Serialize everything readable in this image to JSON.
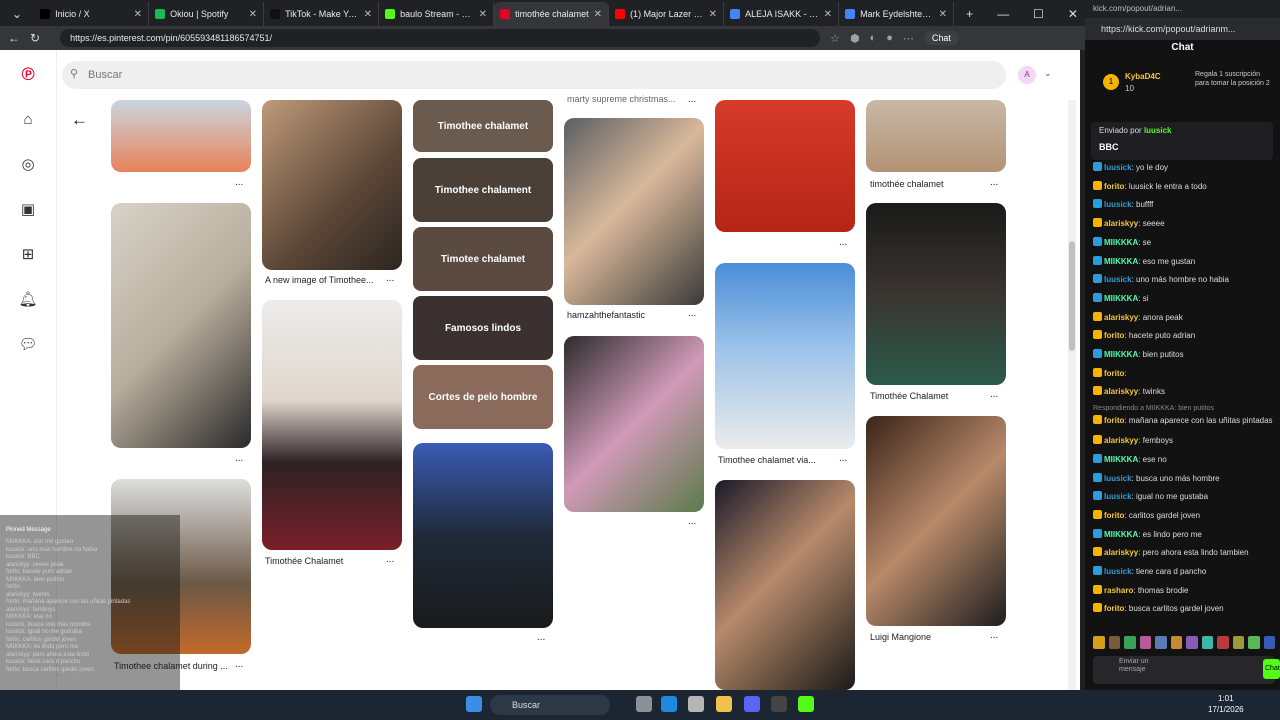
{
  "browser": {
    "tabs": [
      {
        "label": "Inicio / X",
        "icon": "x-logo-icon",
        "color": "#000000",
        "active": false
      },
      {
        "label": "Okiou | Spotify",
        "icon": "spotify-icon",
        "color": "#1db954",
        "active": false
      },
      {
        "label": "TikTok - Make Your Day",
        "icon": "tiktok-icon",
        "color": "#111111",
        "active": false
      },
      {
        "label": "baulo Stream - Watch l",
        "icon": "kick-icon",
        "color": "#53fc18",
        "active": false
      },
      {
        "label": "timothée chalamet",
        "icon": "pinterest-icon",
        "color": "#e60023",
        "active": true
      },
      {
        "label": "(1) Major Lazer & D",
        "icon": "youtube-icon",
        "color": "#ff0000",
        "active": false
      },
      {
        "label": "ALEJA ISAKK - Buscar c",
        "icon": "google-icon",
        "color": "#4285f4",
        "active": false
      },
      {
        "label": "Mark Eydelshteyn - Bus",
        "icon": "google-icon",
        "color": "#4285f4",
        "active": false
      }
    ],
    "url": "https://es.pinterest.com/pin/605593481186574751/",
    "chat_label": "Chat"
  },
  "pinterest": {
    "search_placeholder": "Buscar",
    "avatar_letter": "A",
    "top_cutoff_caption": "marty supreme christmas...",
    "boards": [
      {
        "label": "Timothee chalamet",
        "color": "#6b5a4e"
      },
      {
        "label": "Timothee chalament",
        "color": "#4a4038"
      },
      {
        "label": "Timotee chalamet",
        "color": "#5a4a40"
      },
      {
        "label": "Famosos lindos",
        "color": "#3b3030"
      },
      {
        "label": "Cortes de pelo hombre",
        "color": "#8a6a5a"
      }
    ],
    "pin_captions": {
      "c2_new_image": "A new image of Timothee...",
      "c2_chalamet": "Timothée Chalamet",
      "c4_hamza": "hamzahthefantastic",
      "c5_via": "Timothee chalamet via...",
      "c6_top": "timothée chalamet",
      "c6_mid": "Timothée Chalamet",
      "c6_luigi": "Luigi Mangione",
      "c1_during": "Timothee chalamet during ..."
    },
    "more_dots": "..."
  },
  "kick": {
    "window_title": "kick.com/popout/adrian...",
    "url": "https://kick.com/popout/adrianm...",
    "title": "Chat",
    "gift_user": "KybaD4C",
    "gift_count": "10",
    "gift_text": "Regala 1 suscripción para tomar la posición 2",
    "pinned_by_label": "Enviado por",
    "pinned_by_user": "luusick",
    "pinned_message": "BBC",
    "messages": [
      {
        "user": "luusick",
        "text": "yo le doy",
        "color": "#2d9cdb"
      },
      {
        "user": "forito",
        "text": "luusick le entra a todo",
        "color": "#f5c542"
      },
      {
        "user": "luusick",
        "text": "buffff",
        "color": "#2d9cdb"
      },
      {
        "user": "alariskyy",
        "text": "seeee",
        "color": "#f5c542"
      },
      {
        "user": "MIIKKKA",
        "text": "se",
        "color": "#53fcb0"
      },
      {
        "user": "MIIKKKA",
        "text": "eso me gustan",
        "color": "#53fcb0"
      },
      {
        "user": "luusick",
        "text": "uno más hombre no habia",
        "color": "#2d9cdb"
      },
      {
        "user": "MIIKKKA",
        "text": "si",
        "color": "#53fcb0"
      },
      {
        "user": "alariskyy",
        "text": "anora peak",
        "color": "#f5c542"
      },
      {
        "user": "forito",
        "text": "hacete puto adrian",
        "color": "#f5c542"
      },
      {
        "user": "MIIKKKA",
        "text": "bien putitos",
        "color": "#53fcb0"
      },
      {
        "user": "forito",
        "text": "",
        "color": "#f5c542"
      },
      {
        "user": "alariskyy",
        "text": "twinks",
        "color": "#f5c542"
      },
      {
        "user": "forito",
        "text": "mañana aparece con las uñitas pintadas",
        "color": "#f5c542"
      },
      {
        "user": "alariskyy",
        "text": "femboys",
        "color": "#f5c542"
      },
      {
        "user": "MIIKKKA",
        "text": "ese no",
        "color": "#53fcb0"
      },
      {
        "user": "luusick",
        "text": "busca uno más hombre",
        "color": "#2d9cdb"
      },
      {
        "user": "luusick",
        "text": "igual no me gustaba",
        "color": "#2d9cdb"
      },
      {
        "user": "forito",
        "text": "carlitos gardel joven",
        "color": "#f5c542"
      },
      {
        "user": "MIIKKKA",
        "text": "es lindo pero me",
        "color": "#53fcb0"
      },
      {
        "user": "alariskyy",
        "text": "pero ahora esta lindo tambien",
        "color": "#f5c542"
      },
      {
        "user": "luusick",
        "text": "tiene cara d pancho",
        "color": "#2d9cdb"
      },
      {
        "user": "rasharo",
        "text": "thomas brodie",
        "color": "#f5c542"
      },
      {
        "user": "forito",
        "text": "busca carlitos gardel joven",
        "color": "#f5c542"
      }
    ],
    "reply_label": "Respondiendo a MIIKKKA: bien putitos",
    "input_placeholder": "Enviar un mensaje",
    "send_label": "Chat"
  },
  "overlay": {
    "lines": [
      "MIIKKKA: eso me gustan",
      "luusick: uno más hombre no habia",
      "luusick: BBC",
      "alariskyy: seeee peak",
      "forito: hacete puto adrian",
      "MIIKKKA: bien putitos",
      "forito:",
      "alariskyy: twinks",
      "forito: mañana aparece con las uñitas pintadas",
      "alariskyy: femboys",
      "MIIKKKA: ese no",
      "luusick: busca uno más hombre",
      "luusick: igual no me gustaba",
      "forito: carlitos gardel joven",
      "MIIKKKA: es lindo pero me",
      "alariskyy: pero ahora esta lindo",
      "luusick: tiene cara d pancho",
      "forito: busca carlitos gardel joven"
    ],
    "pinned_label": "Pinned Message",
    "status_url": "/pin/605593481186574751/"
  },
  "taskbar": {
    "search_label": "Buscar",
    "time": "1:01",
    "date": "17/1/2026"
  }
}
